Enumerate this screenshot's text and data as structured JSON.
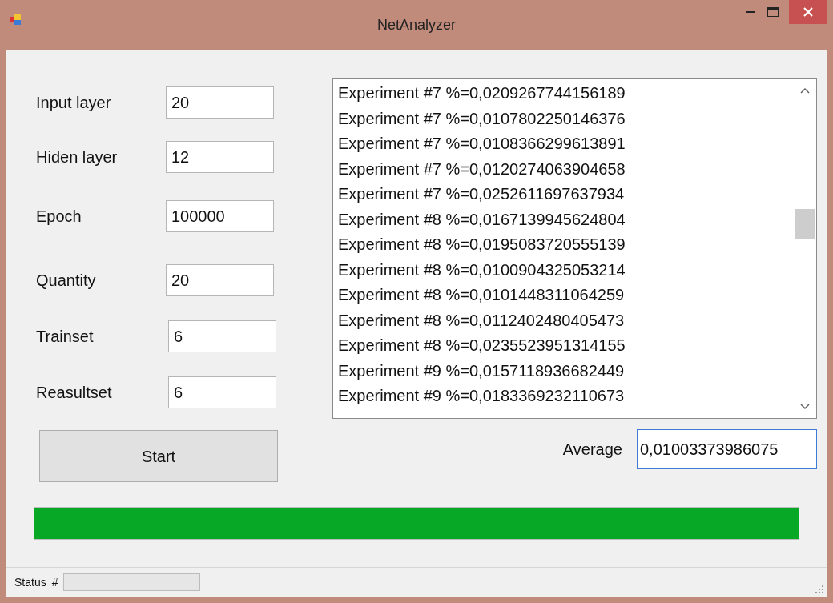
{
  "window": {
    "title": "NetAnalyzer"
  },
  "fields": [
    {
      "label": "Input layer",
      "value": "20"
    },
    {
      "label": "Hiden layer",
      "value": "12"
    },
    {
      "label": "Epoch",
      "value": "100000"
    },
    {
      "label": "Quantity",
      "value": "20"
    },
    {
      "label": "Trainset",
      "value": "6"
    },
    {
      "label": "Reasultset",
      "value": "6"
    }
  ],
  "start_button": "Start",
  "results": [
    "Experiment #7 %=0,0209267744156189",
    "Experiment #7 %=0,0107802250146376",
    "Experiment #7 %=0,0108366299613891",
    "Experiment #7 %=0,0120274063904658",
    "Experiment #7 %=0,0252611697637934",
    "Experiment #8 %=0,0167139945624804",
    "Experiment #8 %=0,0195083720555139",
    "Experiment #8 %=0,0100904325053214",
    "Experiment #8 %=0,0101448311064259",
    "Experiment #8 %=0,0112402480405473",
    "Experiment #8 %=0,0235523951314155",
    "Experiment #9 %=0,0157118936682449",
    "Experiment #9 %=0,0183369232110673"
  ],
  "average": {
    "label": "Average",
    "value": "0,01003373986075"
  },
  "progress": {
    "level": 1
  },
  "status_bar": {
    "label": "Status",
    "hash": "#",
    "progress": {
      "level": 0
    }
  }
}
